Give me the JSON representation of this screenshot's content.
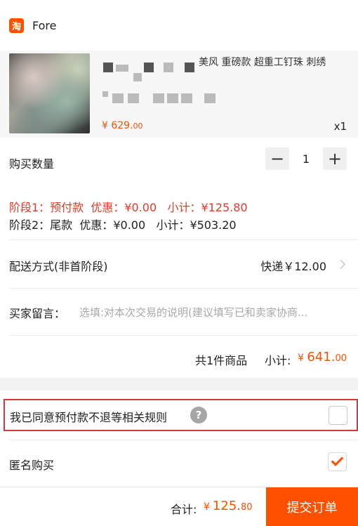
{
  "shop": {
    "icon": "淘",
    "name": "Fore"
  },
  "product": {
    "title": "美风 重磅款 超重工钉珠 刺绣",
    "price_currency": "¥ ",
    "price_int": "629.",
    "price_dec": "00",
    "quantity": "x1"
  },
  "purchase_qty": {
    "label": "购买数量",
    "minus": "−",
    "value": "1",
    "plus": "+"
  },
  "phases": [
    {
      "name": "阶段1：预付款",
      "discount": "优惠：¥0.00",
      "subtotal": "小计：¥125.80"
    },
    {
      "name": "阶段2：尾款",
      "discount": "优惠：¥0.00",
      "subtotal": "小计：¥503.20"
    }
  ],
  "delivery": {
    "label": "配送方式(非首阶段)",
    "value": "快递￥12.00"
  },
  "message": {
    "label": "买家留言：",
    "placeholder": "选填:对本次交易的说明(建议填写已和卖家协商..."
  },
  "summary": {
    "count": "共1件商品",
    "subtotal_label": "小计:",
    "currency": "¥ ",
    "int": "641.",
    "dec": "00"
  },
  "agreement": {
    "label": "我已同意预付款不退等相关规则",
    "help": "?",
    "checked": false
  },
  "anonymous": {
    "label": "匿名购买",
    "checked": true
  },
  "footer": {
    "total_label": "合计:",
    "currency": "¥",
    "int": "125.",
    "dec": "80",
    "submit": "提交订单"
  },
  "colors": {
    "accent": "#ff5000",
    "warning_red": "#e43a28",
    "highlight_border": "#d9363e"
  }
}
